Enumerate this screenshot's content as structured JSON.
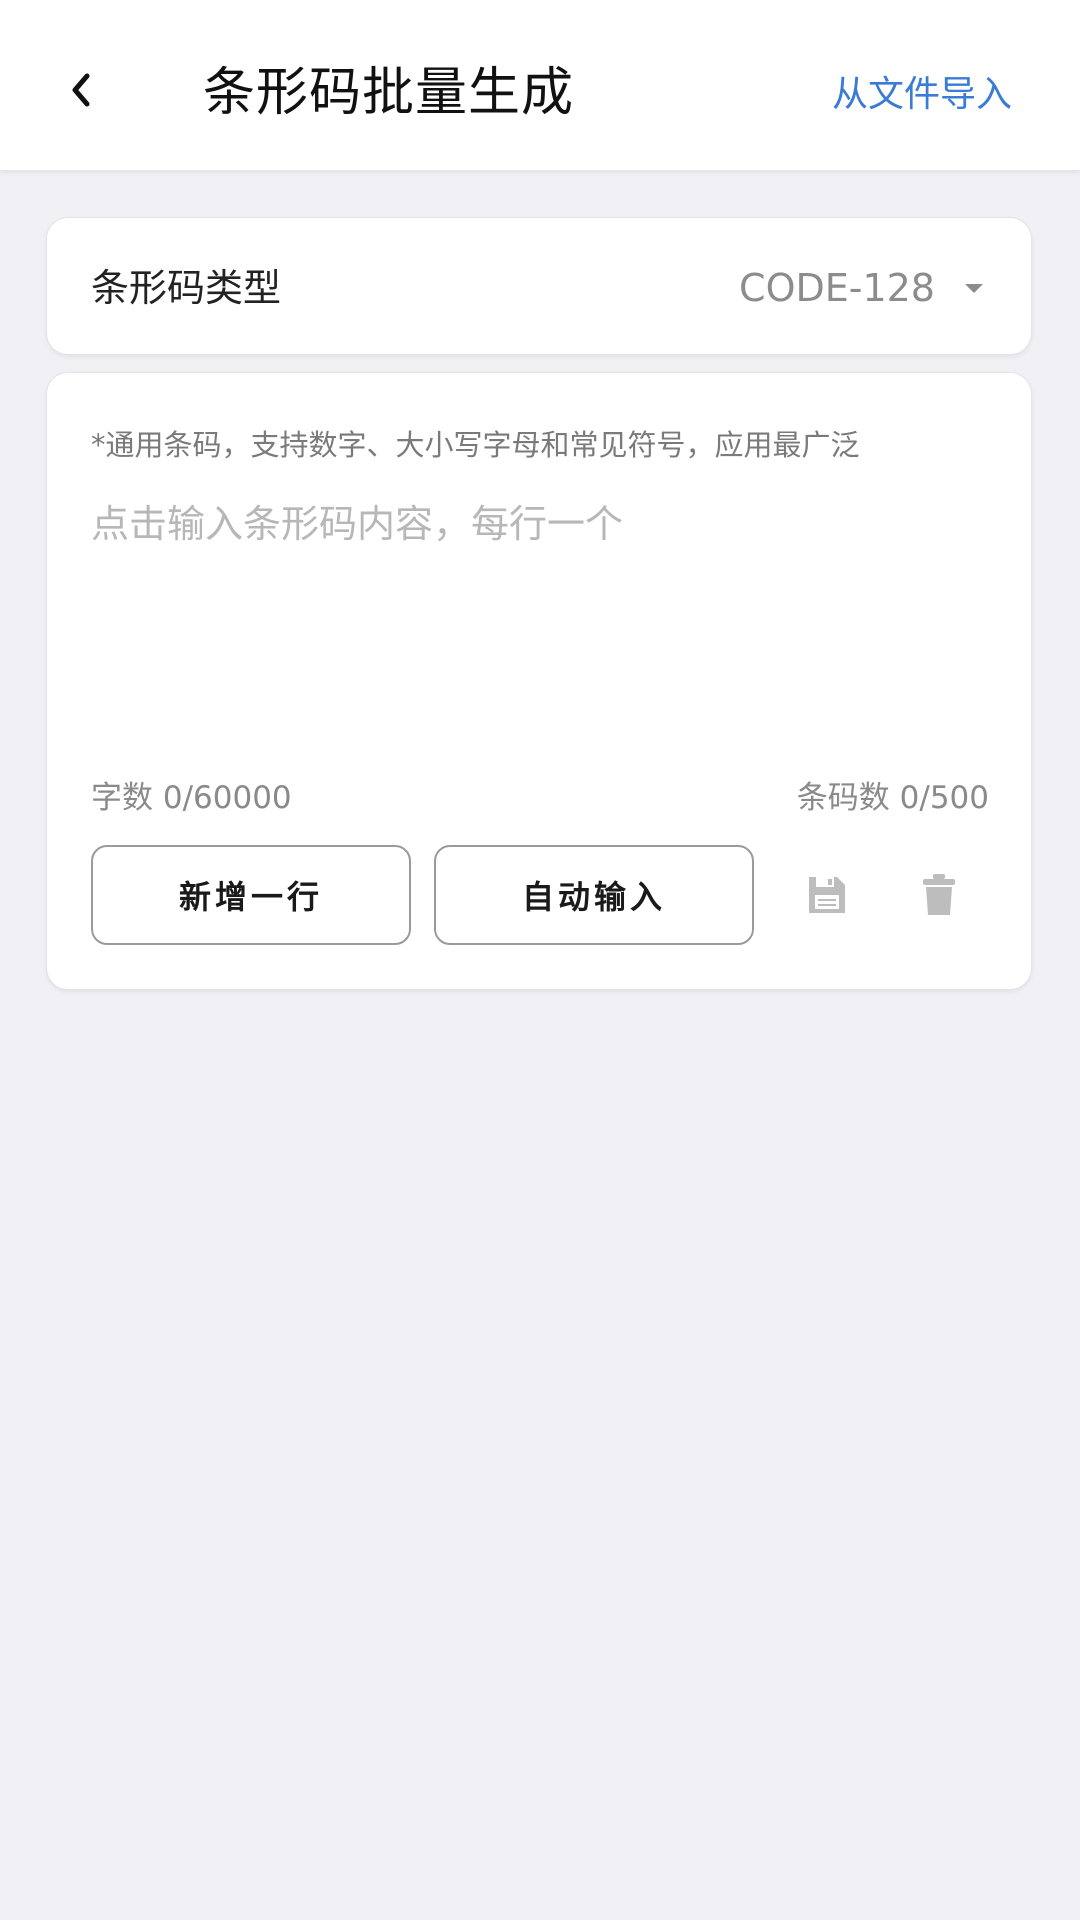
{
  "header": {
    "title": "条形码批量生成",
    "import_label": "从文件导入"
  },
  "barcode_type": {
    "label": "条形码类型",
    "selected": "CODE-128"
  },
  "input_panel": {
    "hint": "*通用条码，支持数字、大小写字母和常见符号，应用最广泛",
    "placeholder": "点击输入条形码内容，每行一个",
    "value": "",
    "char_count": "字数 0/60000",
    "code_count": "条码数 0/500",
    "add_row_label": "新增一行",
    "auto_input_label": "自动输入"
  },
  "colors": {
    "accent": "#3a7bd5",
    "background": "#f0f0f5",
    "icon_gray": "#bdbdbd"
  },
  "icons": {
    "back": "chevron-left-icon",
    "dropdown": "caret-down-icon",
    "save": "floppy-disk-icon",
    "delete": "trash-icon"
  }
}
